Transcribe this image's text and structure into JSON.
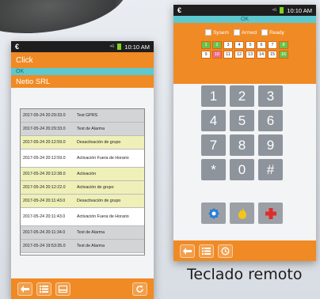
{
  "left_phone": {
    "status": {
      "carrier_icon": "€",
      "signal": "⁴ᴳ",
      "time": "10:10 AM"
    },
    "app_title": "Click",
    "ok_text": "OK",
    "account": "Netio SRL",
    "events": [
      {
        "timestamp": "2017-05-24 20:29:33.0",
        "description": "Test GPRS",
        "row_color": "gray"
      },
      {
        "timestamp": "2017-05-24 20:29:33.0",
        "description": "Test de Alarma",
        "row_color": "gray"
      },
      {
        "timestamp": "2017-05-24 20:12:59.0",
        "description": "Desactivación de grupo",
        "row_color": "yellow"
      },
      {
        "timestamp": "2017-05-24 20:12:59.0",
        "description": "Activación Fuera de Horario",
        "row_color": "white"
      },
      {
        "timestamp": "2017-05-24 20:12:38.0",
        "description": "Activación",
        "row_color": "yellow"
      },
      {
        "timestamp": "2017-05-24 20:12:22.0",
        "description": "Activación de grupo",
        "row_color": "yellow"
      },
      {
        "timestamp": "2017-05-24 20:11:43.0",
        "description": "Desactivación de grupo",
        "row_color": "yellow"
      },
      {
        "timestamp": "2017-05-24 20:11:43.0",
        "description": "Activación Fuera de Horario",
        "row_color": "white"
      },
      {
        "timestamp": "2017-05-24 20:11:34.0",
        "description": "Test de Alarma",
        "row_color": "gray"
      },
      {
        "timestamp": "2017-05-24 19:53:35.0",
        "description": "Test de Alarma",
        "row_color": "gray"
      }
    ],
    "bottom_icons": [
      "back-arrow-icon",
      "list-icon",
      "card-icon",
      "refresh-icon"
    ]
  },
  "right_phone": {
    "status": {
      "carrier_icon": "€",
      "signal": "⁴ᴳ",
      "time": "10:10 AM"
    },
    "ok_text": "OK",
    "checks": [
      "Sysem",
      "Armed",
      "Ready"
    ],
    "zones": [
      {
        "n": "1",
        "color": "green"
      },
      {
        "n": "2",
        "color": "green"
      },
      {
        "n": "3",
        "color": "white"
      },
      {
        "n": "4",
        "color": "white"
      },
      {
        "n": "5",
        "color": "white"
      },
      {
        "n": "6",
        "color": "white"
      },
      {
        "n": "7",
        "color": "white"
      },
      {
        "n": "8",
        "color": "green"
      },
      {
        "n": "9",
        "color": "white"
      },
      {
        "n": "10",
        "color": "pink"
      },
      {
        "n": "11",
        "color": "white"
      },
      {
        "n": "12",
        "color": "white"
      },
      {
        "n": "13",
        "color": "white"
      },
      {
        "n": "14",
        "color": "white"
      },
      {
        "n": "15",
        "color": "white"
      },
      {
        "n": "16",
        "color": "green"
      }
    ],
    "keys": [
      "1",
      "2",
      "3",
      "4",
      "5",
      "6",
      "7",
      "8",
      "9",
      "*",
      "0",
      "#"
    ],
    "emergency_icons": [
      "police-badge-icon",
      "fire-icon",
      "medical-cross-icon"
    ],
    "bottom_icons": [
      "back-arrow-icon",
      "list-icon",
      "history-icon"
    ]
  },
  "caption": "Teclado remoto",
  "colors": {
    "accent": "#f08a24",
    "ok_bar": "#5ec8cf",
    "key": "#8e949b"
  }
}
